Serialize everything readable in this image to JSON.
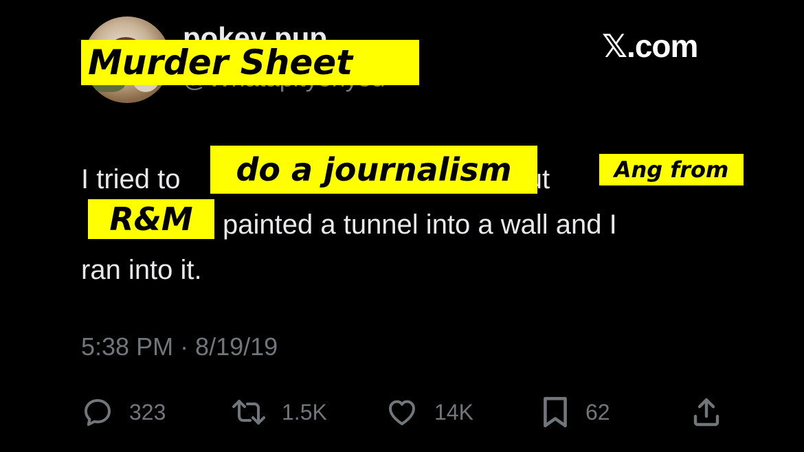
{
  "post": {
    "display_name": "pokey pup",
    "handle": "@Whatapityonyou",
    "text_line1_pre": "I tried to",
    "text_line1_mid": "but",
    "text_line2_post": "painted a tunnel into a wall and I",
    "text_line3": "ran into it.",
    "timestamp": "5:38 PM · 8/19/19"
  },
  "brand": {
    "logo_text": "𝕏.com"
  },
  "overlays": {
    "title": "Murder Sheet",
    "phrase1": "do a journalism",
    "phrase2": "Ang from",
    "phrase3": "R&M"
  },
  "actions": {
    "replies": "323",
    "reposts": "1.5K",
    "likes": "14K",
    "bookmarks": "62"
  },
  "icons": [
    "reply-icon",
    "repost-icon",
    "like-icon",
    "bookmark-icon",
    "share-icon"
  ],
  "colors": {
    "background": "#000000",
    "highlight": "#ffff00",
    "muted": "#71767b",
    "text": "#e7e9ea"
  }
}
